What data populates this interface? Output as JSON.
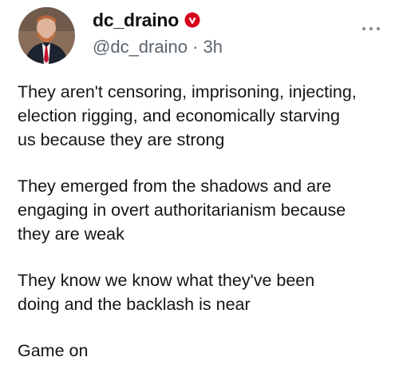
{
  "author": {
    "display_name": "dc_draino",
    "handle": "@dc_draino",
    "separator": "·",
    "time": "3h",
    "verified_badge_color": "#d6001c"
  },
  "tweet": {
    "paragraphs": [
      "They aren't censoring, imprisoning, injecting,\nelection rigging, and economically starving\nus because they are strong",
      "They emerged from the shadows and are\nengaging in overt authoritarianism because\nthey are weak",
      "They know we know what they've been\ndoing and the backlash is near",
      "Game on"
    ]
  },
  "icons": {
    "avatar": "avatar-photo",
    "verified": "verified-badge-icon",
    "more": "more-options-icon"
  }
}
